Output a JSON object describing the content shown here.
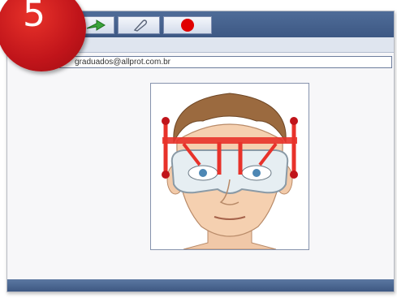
{
  "badge": {
    "number": "5",
    "color": "#c9151b"
  },
  "toolbar": {
    "buttons": [
      {
        "icon": "arrow-icon"
      },
      {
        "icon": "eraser-icon"
      },
      {
        "icon": "record-icon",
        "color": "#e00000"
      }
    ]
  },
  "email_field": {
    "value": "graduados@allprot.com.br"
  },
  "image": {
    "subject": "face-with-glasses-and-frame-gauge"
  },
  "colors": {
    "toolbar": "#4a6592",
    "window": "#f7f7f9"
  }
}
